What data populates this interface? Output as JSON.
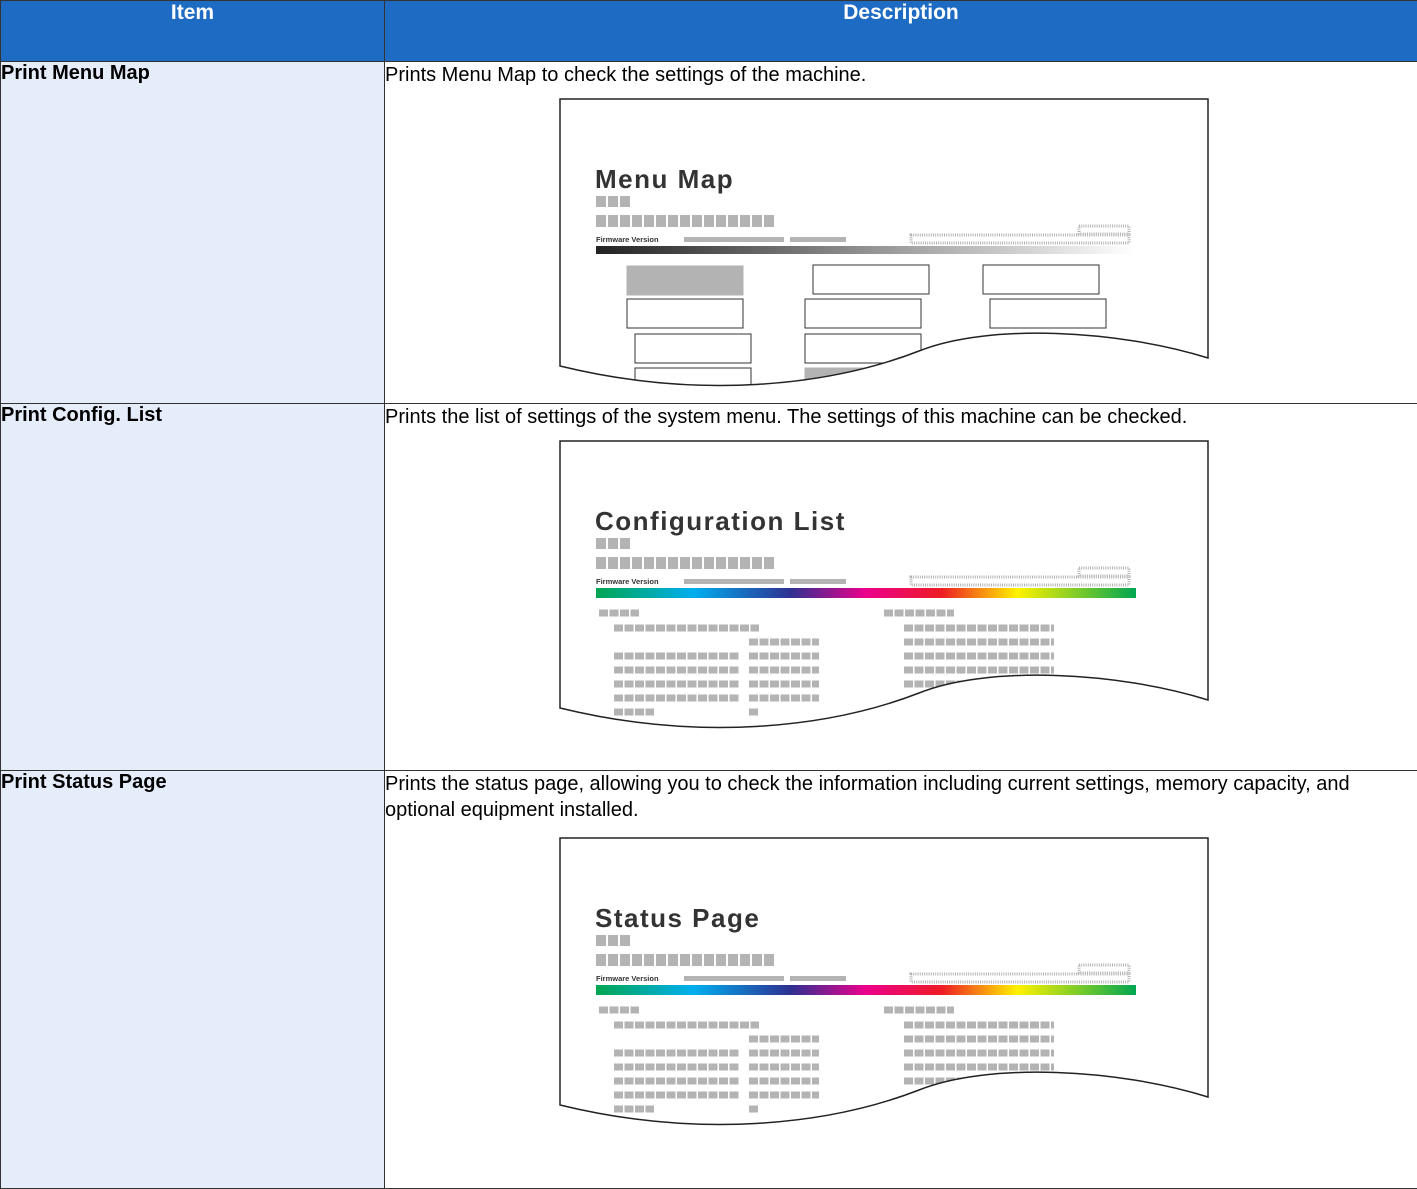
{
  "headers": {
    "item": "Item",
    "description": "Description"
  },
  "rows": [
    {
      "item": "Print Menu Map",
      "description": "Prints Menu Map to check the settings of the machine.",
      "preview_title": "Menu Map",
      "preview_style": "grayscale"
    },
    {
      "item": "Print Config. List",
      "description": "Prints the list of settings of the system menu. The settings of this machine can be checked.",
      "preview_title": "Configuration List",
      "preview_style": "color"
    },
    {
      "item": "Print Status Page",
      "description": "Prints the status page, allowing you to check the information including current settings, memory capacity, and optional equipment installed.",
      "preview_title": "Status Page",
      "preview_style": "color"
    }
  ],
  "preview_common": {
    "firmware_label": "Firmware Version"
  },
  "colors": {
    "header_bg": "#1e6bc4",
    "item_bg": "#e6edfa",
    "placeholder_gray": "#b3b3b3"
  }
}
